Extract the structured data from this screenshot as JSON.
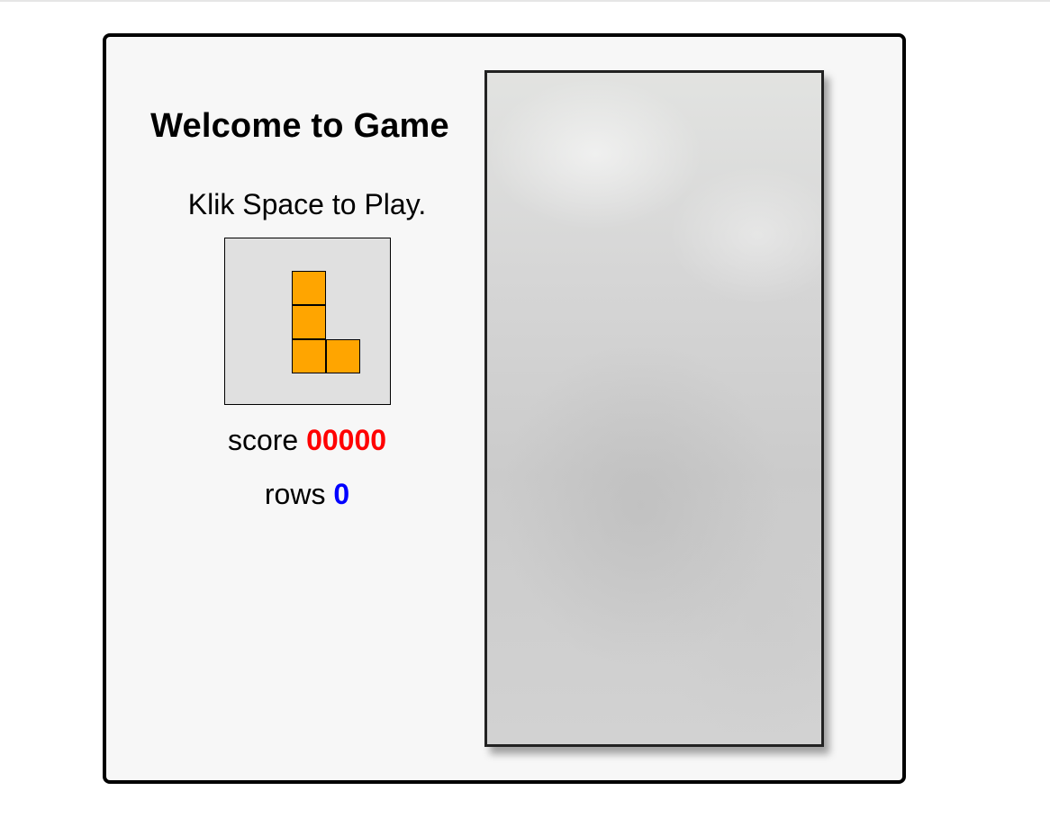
{
  "game": {
    "title": "Welcome to Game",
    "instruction": "Klik Space to Play.",
    "next_piece": {
      "name": "L",
      "color": "#ffa500",
      "cells": [
        [
          0,
          0
        ],
        [
          0,
          1
        ],
        [
          0,
          2
        ],
        [
          1,
          2
        ]
      ]
    },
    "score": {
      "label": "score",
      "value": "00000",
      "color": "#ff0000"
    },
    "rows": {
      "label": "rows",
      "value": "0",
      "color": "#0000ff"
    }
  }
}
